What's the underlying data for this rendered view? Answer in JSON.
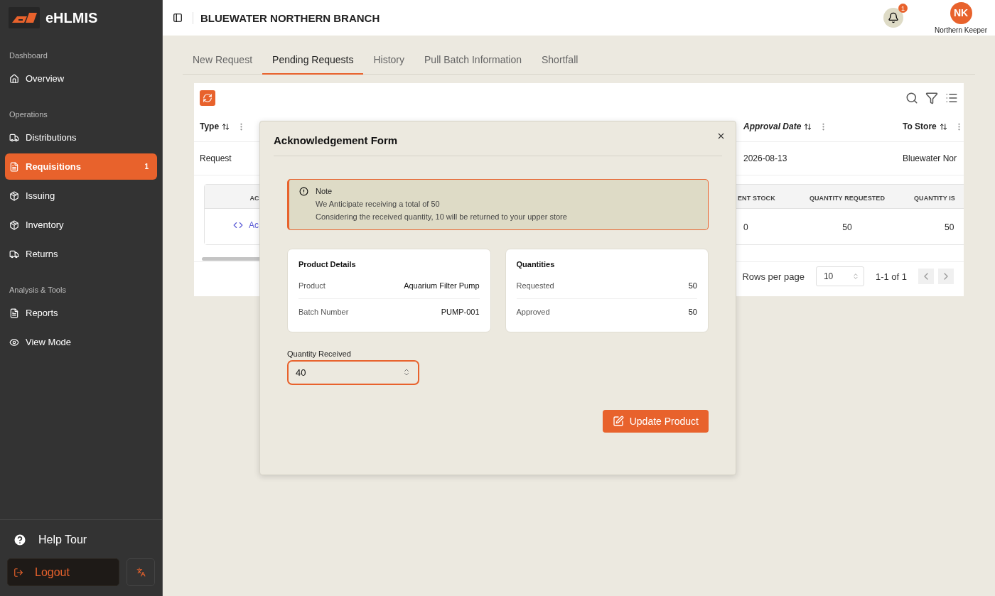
{
  "app": {
    "name": "eHLMIS"
  },
  "sidebar": {
    "sections": [
      {
        "title": "Dashboard",
        "items": [
          {
            "label": "Overview",
            "selected": false
          }
        ]
      },
      {
        "title": "Operations",
        "items": [
          {
            "label": "Distributions",
            "selected": false
          },
          {
            "label": "Requisitions",
            "selected": true,
            "badge": "1"
          },
          {
            "label": "Issuing",
            "selected": false
          },
          {
            "label": "Inventory",
            "selected": false
          },
          {
            "label": "Returns",
            "selected": false
          }
        ]
      },
      {
        "title": "Analysis & Tools",
        "items": [
          {
            "label": "Reports",
            "selected": false
          },
          {
            "label": "View Mode",
            "selected": false
          }
        ]
      }
    ],
    "help": "Help Tour",
    "logout": "Logout"
  },
  "header": {
    "title": "BLUEWATER NORTHERN BRANCH",
    "notifications": "1",
    "user": {
      "initials": "NK",
      "name": "Northern Keeper"
    }
  },
  "tabs": [
    {
      "label": "New Request",
      "selected": false
    },
    {
      "label": "Pending Requests",
      "selected": true
    },
    {
      "label": "History",
      "selected": false
    },
    {
      "label": "Pull Batch Information",
      "selected": false
    },
    {
      "label": "Shortfall",
      "selected": false
    }
  ],
  "table": {
    "columns": [
      {
        "label": "Type",
        "sorted": false
      },
      {
        "label": "Approval Date",
        "sorted": true
      },
      {
        "label": "To Store",
        "sorted": false
      }
    ],
    "rows": [
      {
        "type": "Request",
        "approval_date": "2026-08-13",
        "to_store": "Bluewater Nor"
      }
    ],
    "details": {
      "columns": [
        "AC",
        "ENT STOCK",
        "QUANTITY REQUESTED",
        "QUANTITY IS"
      ],
      "rows": [
        {
          "action": "Ac",
          "stock": "0",
          "requested": "50",
          "issued": "50"
        }
      ]
    },
    "pagination": {
      "label": "Rows per page",
      "rows_per_page": "10",
      "range": "1-1 of 1"
    }
  },
  "modal": {
    "title": "Acknowledgement Form",
    "note": {
      "title": "Note",
      "lines": [
        "We Anticipate receiving a total of 50",
        "Considering the received quantity, 10 will be returned to your upper store"
      ]
    },
    "cards": [
      {
        "title": "Product Details",
        "rows": [
          {
            "label": "Product",
            "value": "Aquarium Filter Pump"
          },
          {
            "label": "Batch Number",
            "value": "PUMP-001"
          }
        ]
      },
      {
        "title": "Quantities",
        "rows": [
          {
            "label": "Requested",
            "value": "50"
          },
          {
            "label": "Approved",
            "value": "50"
          }
        ]
      }
    ],
    "field": {
      "label": "Quantity Received",
      "value": "40"
    },
    "button": "Update Product"
  }
}
